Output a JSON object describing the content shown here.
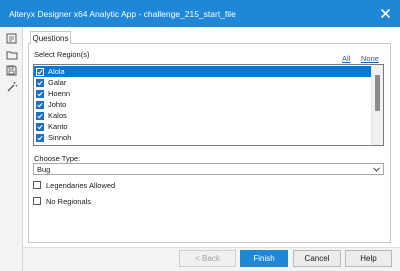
{
  "window": {
    "title": "Alteryx Designer x64 Analytic App - challenge_215_start_file"
  },
  "sidebar": {
    "icons": [
      "form-icon",
      "folder-icon",
      "save-icon",
      "wand-icon"
    ]
  },
  "tabs": [
    {
      "label": "Questions",
      "active": true
    }
  ],
  "region": {
    "label": "Select Region(s)",
    "all_link": "All",
    "none_link": "None",
    "items": [
      {
        "label": "Alola",
        "checked": true,
        "selected": true
      },
      {
        "label": "Galar",
        "checked": true,
        "selected": false
      },
      {
        "label": "Hoenn",
        "checked": true,
        "selected": false
      },
      {
        "label": "Johto",
        "checked": true,
        "selected": false
      },
      {
        "label": "Kalos",
        "checked": true,
        "selected": false
      },
      {
        "label": "Kanto",
        "checked": true,
        "selected": false
      },
      {
        "label": "Sinnoh",
        "checked": true,
        "selected": false
      }
    ]
  },
  "type": {
    "label": "Choose Type:",
    "value": "Bug"
  },
  "options": {
    "legendaries": {
      "label": "Legendaries Allowed",
      "checked": false
    },
    "no_regionals": {
      "label": "No Regionals",
      "checked": false
    }
  },
  "footer": {
    "back_label": "< Back",
    "finish_label": "Finish",
    "cancel_label": "Cancel",
    "help_label": "Help"
  },
  "colors": {
    "accent": "#1e87d8",
    "selection": "#0078d7",
    "link": "#1a5fb4"
  }
}
